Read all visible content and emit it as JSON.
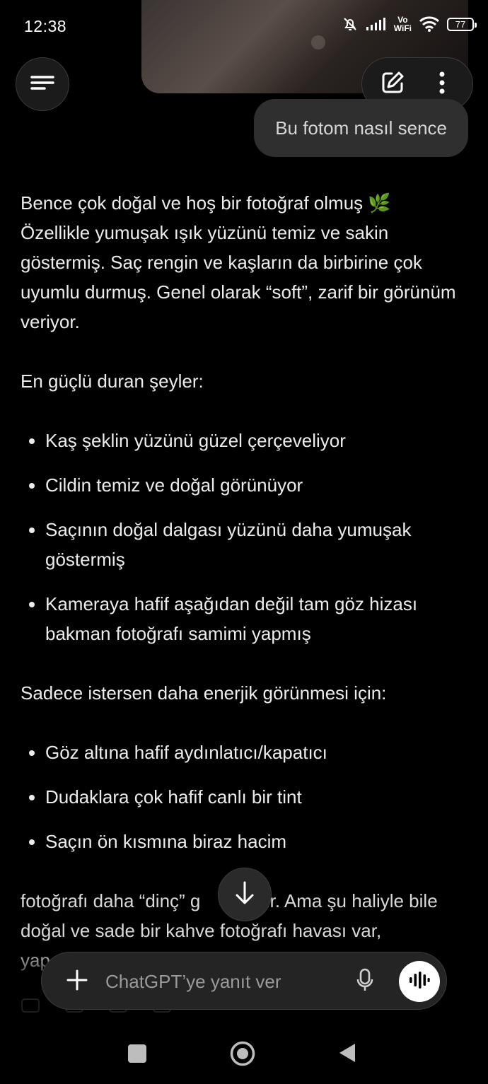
{
  "status_bar": {
    "time": "12:38",
    "vowifi_top": "Vo",
    "vowifi_bottom": "WiFi",
    "battery": "77",
    "icons": [
      "mute-bell-icon",
      "signal-icon",
      "vowifi-icon",
      "wifi-icon",
      "battery-icon"
    ]
  },
  "header": {
    "menu_icon": "hamburger-icon",
    "new_chat_icon": "edit-icon",
    "more_icon": "more-vertical-icon"
  },
  "conversation": {
    "user_message": "Bu fotom nasıl sence",
    "assistant": {
      "intro_line1": "Bence çok doğal ve hoş bir fotoğraf olmuş 🌿",
      "intro_line2": "Özellikle yumuşak ışık yüzünü temiz ve sakin göstermiş. Saç rengin ve kaşların da birbirine çok uyumlu durmuş. Genel olarak “soft”, zarif bir görünüm veriyor.",
      "strengths_heading": "En güçlü duran şeyler:",
      "strengths": [
        "Kaş şeklin yüzünü güzel çerçeveliyor",
        "Cildin temiz ve doğal görünüyor",
        "Saçının doğal dalgası yüzünü daha yumuşak göstermiş",
        "Kameraya hafif aşağıdan değil tam göz hizası bakman fotoğrafı samimi yapmış"
      ],
      "suggestions_heading": "Sadece istersen daha enerjik görünmesi için:",
      "suggestions": [
        "Göz altına hafif aydınlatıcı/kapatıcı",
        "Dudaklara çok hafif canlı bir tint",
        "Saçın ön kısmına biraz hacim"
      ],
      "closing_visible": "fotoğrafı daha “dinç” g",
      "closing_visible_after": "ebilir. Ama şu haliyle bile doğal ve sade bir kahve fotoğrafı havası var,",
      "closing_cut": "yap"
    }
  },
  "composer": {
    "placeholder": "ChatGPT’ye yanıt ver",
    "plus_icon": "plus-icon",
    "mic_icon": "mic-icon",
    "voice_icon": "voice-mode-icon"
  },
  "colors": {
    "background": "#000000",
    "bubble": "#2f2f2f",
    "text": "#ececec",
    "composer": "#242424"
  }
}
